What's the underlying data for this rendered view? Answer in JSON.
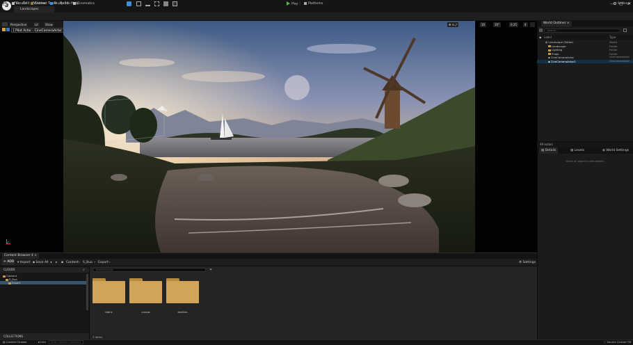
{
  "titlebar": {
    "menu": [
      "File",
      "Edit",
      "Window",
      "Tools",
      "Build",
      "Help"
    ],
    "project_tab": "Landscapes",
    "window_controls": [
      "—",
      "▢",
      "✕"
    ]
  },
  "toolbar": {
    "save": "💾",
    "create": "Create",
    "content": "Content",
    "blueprints": "Blueprints",
    "cinematics": "Cinematics",
    "play": "Play",
    "platforms": "Platforms",
    "settings": "Settings"
  },
  "viewport": {
    "perspective": "Perspective",
    "lit": "Lit",
    "show": "Show",
    "pilot_label": "[ Pilot Actor - CineCameraActor ]",
    "grid_snap": "10",
    "rotation_snap": "10°",
    "scale_snap": "0.25",
    "camera_speed": "4"
  },
  "outliner": {
    "tab": "World Outliner",
    "search_placeholder": "Search...",
    "col_label": "Label",
    "col_type": "Type",
    "rows": [
      {
        "label": "Landscape (Editor)",
        "type": "World"
      },
      {
        "label": "Landscape",
        "type": "Folder"
      },
      {
        "label": "Lighting",
        "type": "Folder"
      },
      {
        "label": "Props",
        "type": "Folder"
      },
      {
        "label": "CineCameraActor",
        "type": "CineCameraActor"
      },
      {
        "label": "CineCameraActor2",
        "type": "CineCameraActor"
      }
    ],
    "actors_count": "49 actors"
  },
  "details": {
    "tabs": [
      "Details",
      "Levels",
      "World Settings"
    ],
    "empty_message": "Select an object to view details."
  },
  "content_browser": {
    "tab": "Content Browser 4",
    "add": "+ ADD",
    "import": "Import",
    "save_all": "Save All",
    "path": [
      "Content",
      "S_Bua",
      "Export"
    ],
    "settings": "Settings",
    "favorites_header": "CLOUDS",
    "tree": [
      {
        "label": "Content"
      },
      {
        "label": "S_Bua"
      },
      {
        "label": "Export"
      }
    ],
    "search_placeholder": "Search Export",
    "folders": [
      "fabric",
      "clouds",
      "textiles"
    ],
    "item_count": "3 items",
    "collections": "COLLECTIONS"
  },
  "status": {
    "content_drawer": "Content Drawer",
    "cmd": "Cmd",
    "cmd_placeholder": "Enter Console Command",
    "source_control": "Source Control Off"
  },
  "colors": {
    "accent_blue": "#133147",
    "selection": "#38536a",
    "folder": "#d0a55a",
    "play_green": "#56b94a"
  }
}
